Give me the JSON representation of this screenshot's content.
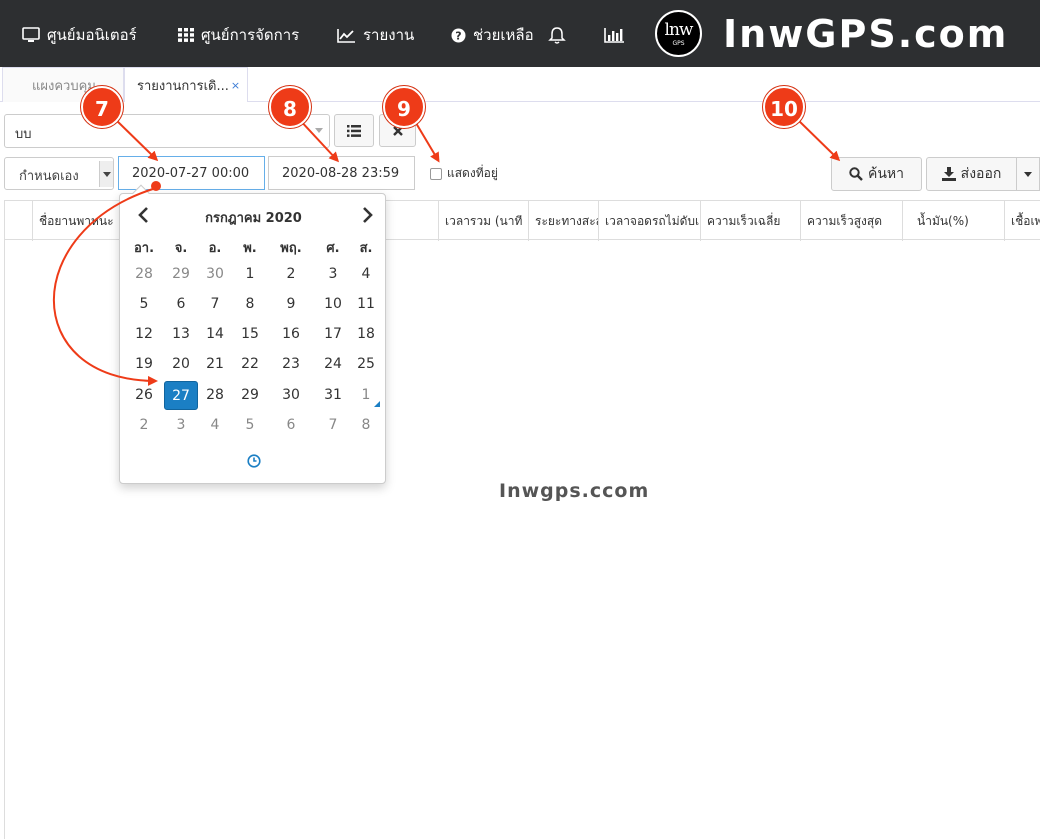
{
  "nav": {
    "monitor": "ศูนย์มอนิเตอร์",
    "management": "ศูนย์การจัดการ",
    "report": "รายงาน",
    "help": "ช่วยเหลือ",
    "brand_logo_line1": "lnw",
    "brand_logo_line2": "GPS",
    "brand_text": "InwGPS.com"
  },
  "tabs": [
    {
      "label": "แผงควบคุม"
    },
    {
      "label": "รายงานการเดิ...",
      "close": "×"
    }
  ],
  "filters": {
    "vehicle": "บบ",
    "range_mode": "กำหนดเอง",
    "start": "2020-07-27 00:00",
    "end": "2020-08-28 23:59",
    "show_address_label": "แสดงที่อยู่",
    "search_label": "ค้นหา",
    "export_label": "ส่งออก"
  },
  "table": {
    "columns": [
      "ชื่อยานพาหนะ",
      "เวลารวม (นาที",
      "ระยะทางสะสม",
      "เวลาจอดรถไม่ดับเครื่อง",
      "ความเร็วเฉลี่ย",
      "ความเร็วสูงสุด",
      "น้ำมัน(%)",
      "เชื้อเพลิง"
    ]
  },
  "watermark": "Inwgps.ccom",
  "datepicker": {
    "title": "กรกฎาคม 2020",
    "weekdays": [
      "อา.",
      "จ.",
      "อ.",
      "พ.",
      "พฤ.",
      "ศ.",
      "ส."
    ],
    "weeks": [
      [
        "28",
        "29",
        "30",
        "1",
        "2",
        "3",
        "4"
      ],
      [
        "5",
        "6",
        "7",
        "8",
        "9",
        "10",
        "11"
      ],
      [
        "12",
        "13",
        "14",
        "15",
        "16",
        "17",
        "18"
      ],
      [
        "19",
        "20",
        "21",
        "22",
        "23",
        "24",
        "25"
      ],
      [
        "26",
        "27",
        "28",
        "29",
        "30",
        "31",
        "1"
      ],
      [
        "2",
        "3",
        "4",
        "5",
        "6",
        "7",
        "8"
      ]
    ],
    "selected_day": "27"
  },
  "annotations": [
    "7",
    "8",
    "9",
    "10"
  ],
  "colors": {
    "topbar": "#2d2f31",
    "accent_blue": "#1b7fc4",
    "marker_red": "#ee3b18"
  }
}
